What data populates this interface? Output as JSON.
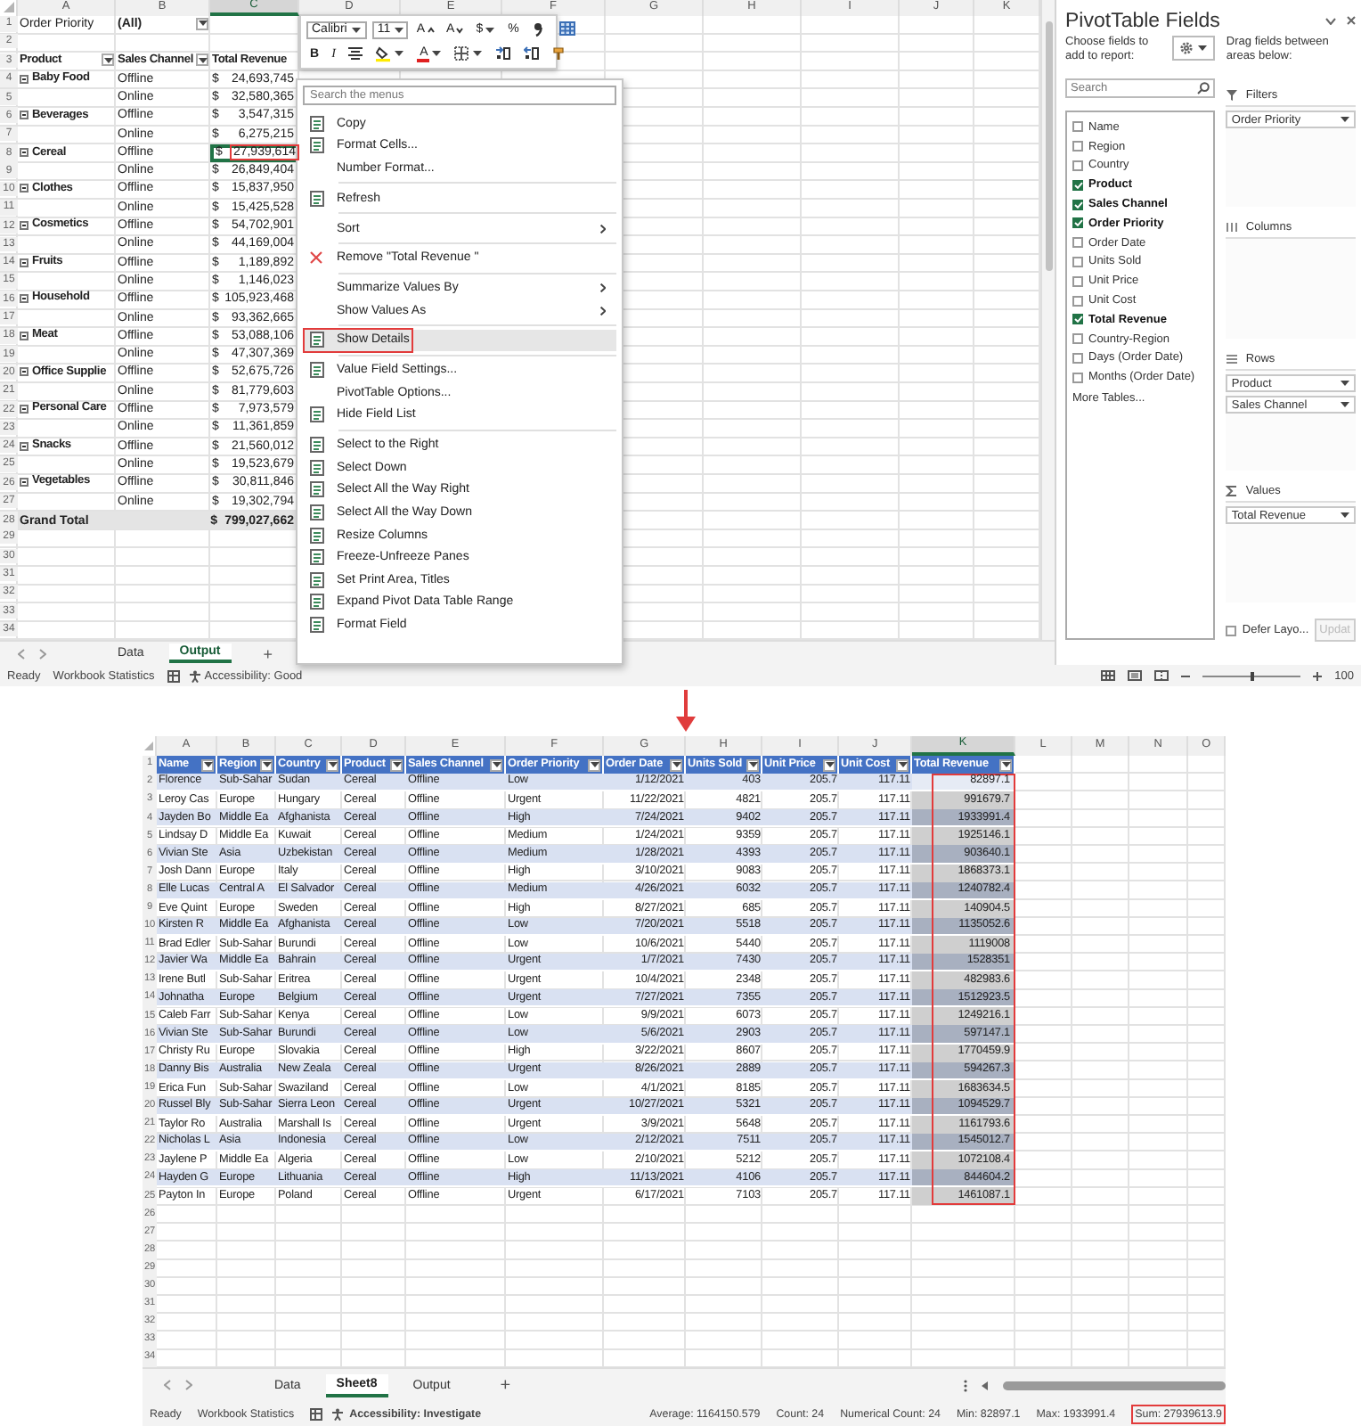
{
  "pivot_sheet": {
    "column_headers": [
      {
        "label": "A",
        "selected": false
      },
      {
        "label": "B",
        "selected": false
      },
      {
        "label": "C",
        "selected": true
      },
      {
        "label": "D",
        "selected": false
      },
      {
        "label": "E",
        "selected": false
      },
      {
        "label": "F",
        "selected": false
      },
      {
        "label": "G",
        "selected": false
      },
      {
        "label": "H",
        "selected": false
      },
      {
        "label": "I",
        "selected": false
      },
      {
        "label": "J",
        "selected": false
      },
      {
        "label": "K",
        "selected": false
      }
    ],
    "row_numbers": [
      "1",
      "2",
      "3",
      "4",
      "5",
      "6",
      "7",
      "8",
      "9",
      "10",
      "11",
      "12",
      "13",
      "14",
      "15",
      "16",
      "17",
      "18",
      "19",
      "20",
      "21",
      "22",
      "23",
      "24",
      "25",
      "26",
      "27",
      "28",
      "29",
      "30",
      "31",
      "32",
      "33",
      "34"
    ],
    "filter": {
      "label": "Order Priority",
      "value": "(All)"
    },
    "headers": [
      "Product",
      "Sales Channel",
      "Total Revenue"
    ],
    "groups": [
      {
        "product": "Baby Food",
        "rows": [
          {
            "channel": "Offline",
            "currency": "$",
            "revenue": "24,693,745",
            "selected": false
          },
          {
            "channel": "Online",
            "currency": "$",
            "revenue": "32,580,365",
            "selected": false
          }
        ]
      },
      {
        "product": "Beverages",
        "rows": [
          {
            "channel": "Offline",
            "currency": "$",
            "revenue": "3,547,315",
            "selected": false
          },
          {
            "channel": "Online",
            "currency": "$",
            "revenue": "6,275,215",
            "selected": false
          }
        ]
      },
      {
        "product": "Cereal",
        "rows": [
          {
            "channel": "Offline",
            "currency": "$",
            "revenue": "27,939,614",
            "selected": true
          },
          {
            "channel": "Online",
            "currency": "$",
            "revenue": "26,849,404",
            "selected": false
          }
        ]
      },
      {
        "product": "Clothes",
        "rows": [
          {
            "channel": "Offline",
            "currency": "$",
            "revenue": "15,837,950",
            "selected": false
          },
          {
            "channel": "Online",
            "currency": "$",
            "revenue": "15,425,528",
            "selected": false
          }
        ]
      },
      {
        "product": "Cosmetics",
        "rows": [
          {
            "channel": "Offline",
            "currency": "$",
            "revenue": "54,702,901",
            "selected": false
          },
          {
            "channel": "Online",
            "currency": "$",
            "revenue": "44,169,004",
            "selected": false
          }
        ]
      },
      {
        "product": "Fruits",
        "rows": [
          {
            "channel": "Offline",
            "currency": "$",
            "revenue": "1,189,892",
            "selected": false
          },
          {
            "channel": "Online",
            "currency": "$",
            "revenue": "1,146,023",
            "selected": false
          }
        ]
      },
      {
        "product": "Household",
        "rows": [
          {
            "channel": "Offline",
            "currency": "$",
            "revenue": "105,923,468",
            "selected": false
          },
          {
            "channel": "Online",
            "currency": "$",
            "revenue": "93,362,665",
            "selected": false
          }
        ]
      },
      {
        "product": "Meat",
        "rows": [
          {
            "channel": "Offline",
            "currency": "$",
            "revenue": "53,088,106",
            "selected": false
          },
          {
            "channel": "Online",
            "currency": "$",
            "revenue": "47,307,369",
            "selected": false
          }
        ]
      },
      {
        "product": "Office Supplie",
        "rows": [
          {
            "channel": "Offline",
            "currency": "$",
            "revenue": "52,675,726",
            "selected": false
          },
          {
            "channel": "Online",
            "currency": "$",
            "revenue": "81,779,603",
            "selected": false
          }
        ]
      },
      {
        "product": "Personal Care",
        "rows": [
          {
            "channel": "Offline",
            "currency": "$",
            "revenue": "7,973,579",
            "selected": false
          },
          {
            "channel": "Online",
            "currency": "$",
            "revenue": "11,361,859",
            "selected": false
          }
        ]
      },
      {
        "product": "Snacks",
        "rows": [
          {
            "channel": "Offline",
            "currency": "$",
            "revenue": "21,560,012",
            "selected": false
          },
          {
            "channel": "Online",
            "currency": "$",
            "revenue": "19,523,679",
            "selected": false
          }
        ]
      },
      {
        "product": "Vegetables",
        "rows": [
          {
            "channel": "Offline",
            "currency": "$",
            "revenue": "30,811,846",
            "selected": false
          },
          {
            "channel": "Online",
            "currency": "$",
            "revenue": "19,302,794",
            "selected": false
          }
        ]
      }
    ],
    "grand_total": {
      "label": "Grand Total",
      "currency": "$",
      "value": "799,027,662"
    },
    "sheet_tabs": [
      {
        "label": "Data",
        "selected": false
      },
      {
        "label": "Output",
        "selected": true
      }
    ],
    "add_sheet": "+"
  },
  "status_bar": {
    "items": [
      "Ready",
      "Workbook Statistics"
    ],
    "accessibility": "Accessibility: Good",
    "zoom_slider": {
      "level": 0.5
    },
    "zoom": "100"
  },
  "mini_toolbar": {
    "font": "Calibri",
    "size": "11",
    "top_row": [
      {
        "kind": "grow",
        "label": "A"
      },
      {
        "kind": "shrink",
        "label": "A"
      },
      {
        "kind": "currency",
        "label": "$"
      },
      {
        "kind": "percent",
        "label": "%"
      },
      {
        "kind": "comma"
      },
      {
        "kind": "table"
      }
    ],
    "bottom_row": [
      {
        "kind": "bold",
        "label": "B"
      },
      {
        "kind": "italic",
        "label": "I"
      },
      {
        "kind": "align"
      },
      {
        "kind": "fill"
      },
      {
        "kind": "fontcolor",
        "label": "A"
      },
      {
        "kind": "border"
      },
      {
        "kind": "increase"
      },
      {
        "kind": "decrease"
      },
      {
        "kind": "brush"
      }
    ]
  },
  "context_menu": {
    "search_placeholder": "Search the menus",
    "groups": [
      [
        {
          "label": "Copy",
          "kind": "icon",
          "highlighted": false
        },
        {
          "label": "Format Cells...",
          "kind": "icon",
          "highlighted": false
        },
        {
          "label": "Number Format...",
          "kind": "plain",
          "highlighted": false
        }
      ],
      [
        {
          "label": "Refresh",
          "kind": "icon",
          "highlighted": false
        }
      ],
      [
        {
          "label": "Sort",
          "kind": "submenu",
          "highlighted": false
        }
      ],
      [
        {
          "label": "Remove \"Total Revenue \"",
          "kind": "remove",
          "highlighted": false
        }
      ],
      [
        {
          "label": "Summarize Values By",
          "kind": "submenu",
          "highlighted": false
        },
        {
          "label": "Show Values As",
          "kind": "submenu",
          "highlighted": false
        }
      ],
      [
        {
          "label": "Show Details",
          "kind": "icon",
          "highlighted": true
        }
      ],
      [
        {
          "label": "Value Field Settings...",
          "kind": "icon",
          "highlighted": false
        },
        {
          "label": "PivotTable Options...",
          "kind": "plain",
          "highlighted": false
        },
        {
          "label": "Hide Field List",
          "kind": "icon",
          "highlighted": false
        }
      ],
      [
        {
          "label": "Select to the Right",
          "kind": "icon",
          "highlighted": false
        },
        {
          "label": "Select Down",
          "kind": "icon",
          "highlighted": false
        },
        {
          "label": "Select All the Way Right",
          "kind": "icon",
          "highlighted": false
        },
        {
          "label": "Select All the Way Down",
          "kind": "icon",
          "highlighted": false
        },
        {
          "label": "Resize Columns",
          "kind": "icon",
          "highlighted": false
        },
        {
          "label": "Freeze-Unfreeze Panes",
          "kind": "icon",
          "highlighted": false
        },
        {
          "label": "Set Print Area, Titles",
          "kind": "icon",
          "highlighted": false
        },
        {
          "label": "Expand Pivot Data Table Range",
          "kind": "icon",
          "highlighted": false
        },
        {
          "label": "Format Field",
          "kind": "icon",
          "highlighted": false
        }
      ]
    ]
  },
  "pivot_fields": {
    "title": "PivotTable Fields",
    "choose_label": "Choose fields to add to report:",
    "search_placeholder": "Search",
    "fields": [
      {
        "label": "Name",
        "checked": false
      },
      {
        "label": "Region",
        "checked": false
      },
      {
        "label": "Country",
        "checked": false
      },
      {
        "label": "Product",
        "checked": true
      },
      {
        "label": "Sales Channel",
        "checked": true
      },
      {
        "label": "Order Priority",
        "checked": true
      },
      {
        "label": "Order Date",
        "checked": false
      },
      {
        "label": "Units Sold",
        "checked": false
      },
      {
        "label": "Unit Price",
        "checked": false
      },
      {
        "label": "Unit Cost",
        "checked": false
      },
      {
        "label": "Total Revenue",
        "checked": true
      },
      {
        "label": "Country-Region",
        "checked": false
      },
      {
        "label": "Days (Order Date)",
        "checked": false
      },
      {
        "label": "Months (Order Date)",
        "checked": false
      }
    ],
    "more_tables": "More Tables...",
    "drag_label": "Drag fields between areas below:",
    "areas": [
      {
        "kind": "filters",
        "label": "Filters",
        "fields": [
          "Order Priority"
        ]
      },
      {
        "kind": "columns",
        "label": "Columns"
      },
      {
        "kind": "rows",
        "label": "Rows",
        "fields": [
          "Product",
          "Sales Channel"
        ]
      },
      {
        "kind": "values",
        "label": "Values",
        "fields": [
          "Total Revenue"
        ]
      }
    ],
    "defer": {
      "label": "Defer Layo...",
      "checked": false
    },
    "update": {
      "label": "Updat",
      "disabled": true
    }
  },
  "detail_sheet": {
    "column_headers": [
      {
        "label": "A",
        "selected": false
      },
      {
        "label": "B",
        "selected": false
      },
      {
        "label": "C",
        "selected": false
      },
      {
        "label": "D",
        "selected": false
      },
      {
        "label": "E",
        "selected": false
      },
      {
        "label": "F",
        "selected": false
      },
      {
        "label": "G",
        "selected": false
      },
      {
        "label": "H",
        "selected": false
      },
      {
        "label": "I",
        "selected": false
      },
      {
        "label": "J",
        "selected": false
      },
      {
        "label": "K",
        "selected": true
      },
      {
        "label": "L",
        "selected": false
      },
      {
        "label": "M",
        "selected": false
      },
      {
        "label": "N",
        "selected": false
      },
      {
        "label": "O",
        "selected": false
      }
    ],
    "row_numbers": [
      "1",
      "2",
      "3",
      "4",
      "5",
      "6",
      "7",
      "8",
      "9",
      "10",
      "11",
      "12",
      "13",
      "14",
      "15",
      "16",
      "17",
      "18",
      "19",
      "20",
      "21",
      "22",
      "23",
      "24",
      "25",
      "26",
      "27",
      "28",
      "29",
      "30",
      "31",
      "32",
      "33",
      "34"
    ],
    "columns": [
      "Name",
      "Region",
      "Country",
      "Product",
      "Sales Channel",
      "Order Priority",
      "Order Date",
      "Units Sold",
      "Unit Price",
      "Unit Cost",
      "Total Revenue"
    ],
    "rows": [
      [
        "Florence",
        "Sub-Sahar",
        "Sudan",
        "Cereal",
        "Offline",
        "Low",
        "1/12/2021",
        "403",
        "205.7",
        "117.11",
        "82897.1"
      ],
      [
        "Leroy Cas",
        "Europe",
        "Hungary",
        "Cereal",
        "Offline",
        "Urgent",
        "11/22/2021",
        "4821",
        "205.7",
        "117.11",
        "991679.7"
      ],
      [
        "Jayden Bo",
        "Middle Ea",
        "Afghanista",
        "Cereal",
        "Offline",
        "High",
        "7/24/2021",
        "9402",
        "205.7",
        "117.11",
        "1933991.4"
      ],
      [
        "Lindsay D",
        "Middle Ea",
        "Kuwait",
        "Cereal",
        "Offline",
        "Medium",
        "1/24/2021",
        "9359",
        "205.7",
        "117.11",
        "1925146.1"
      ],
      [
        "Vivian Ste",
        "Asia",
        "Uzbekistan",
        "Cereal",
        "Offline",
        "Medium",
        "1/28/2021",
        "4393",
        "205.7",
        "117.11",
        "903640.1"
      ],
      [
        "Josh Dann",
        "Europe",
        "Italy",
        "Cereal",
        "Offline",
        "High",
        "3/10/2021",
        "9083",
        "205.7",
        "117.11",
        "1868373.1"
      ],
      [
        "Elle Lucas",
        "Central A",
        "El Salvador",
        "Cereal",
        "Offline",
        "Medium",
        "4/26/2021",
        "6032",
        "205.7",
        "117.11",
        "1240782.4"
      ],
      [
        "Eve Quint",
        "Europe",
        "Sweden",
        "Cereal",
        "Offline",
        "High",
        "8/27/2021",
        "685",
        "205.7",
        "117.11",
        "140904.5"
      ],
      [
        "Kirsten R",
        "Middle Ea",
        "Afghanista",
        "Cereal",
        "Offline",
        "Low",
        "7/20/2021",
        "5518",
        "205.7",
        "117.11",
        "1135052.6"
      ],
      [
        "Brad Edler",
        "Sub-Sahar",
        "Burundi",
        "Cereal",
        "Offline",
        "Low",
        "10/6/2021",
        "5440",
        "205.7",
        "117.11",
        "1119008"
      ],
      [
        "Javier Wa",
        "Middle Ea",
        "Bahrain",
        "Cereal",
        "Offline",
        "Urgent",
        "1/7/2021",
        "7430",
        "205.7",
        "117.11",
        "1528351"
      ],
      [
        "Irene Butl",
        "Sub-Sahar",
        "Eritrea",
        "Cereal",
        "Offline",
        "Urgent",
        "10/4/2021",
        "2348",
        "205.7",
        "117.11",
        "482983.6"
      ],
      [
        "Johnatha",
        "Europe",
        "Belgium",
        "Cereal",
        "Offline",
        "Urgent",
        "7/27/2021",
        "7355",
        "205.7",
        "117.11",
        "1512923.5"
      ],
      [
        "Caleb Farr",
        "Sub-Sahar",
        "Kenya",
        "Cereal",
        "Offline",
        "Low",
        "9/9/2021",
        "6073",
        "205.7",
        "117.11",
        "1249216.1"
      ],
      [
        "Vivian Ste",
        "Sub-Sahar",
        "Burundi",
        "Cereal",
        "Offline",
        "Low",
        "5/6/2021",
        "2903",
        "205.7",
        "117.11",
        "597147.1"
      ],
      [
        "Christy Ru",
        "Europe",
        "Slovakia",
        "Cereal",
        "Offline",
        "High",
        "3/22/2021",
        "8607",
        "205.7",
        "117.11",
        "1770459.9"
      ],
      [
        "Danny Bis",
        "Australia",
        "New Zeala",
        "Cereal",
        "Offline",
        "Urgent",
        "8/26/2021",
        "2889",
        "205.7",
        "117.11",
        "594267.3"
      ],
      [
        "Erica Fun",
        "Sub-Sahar",
        "Swaziland",
        "Cereal",
        "Offline",
        "Low",
        "4/1/2021",
        "8185",
        "205.7",
        "117.11",
        "1683634.5"
      ],
      [
        "Russel Bly",
        "Sub-Sahar",
        "Sierra Leon",
        "Cereal",
        "Offline",
        "Urgent",
        "10/27/2021",
        "5321",
        "205.7",
        "117.11",
        "1094529.7"
      ],
      [
        "Taylor Ro",
        "Australia",
        "Marshall Is",
        "Cereal",
        "Offline",
        "Urgent",
        "3/9/2021",
        "5648",
        "205.7",
        "117.11",
        "1161793.6"
      ],
      [
        "Nicholas L",
        "Asia",
        "Indonesia",
        "Cereal",
        "Offline",
        "Low",
        "2/12/2021",
        "7511",
        "205.7",
        "117.11",
        "1545012.7"
      ],
      [
        "Jaylene P",
        "Middle Ea",
        "Algeria",
        "Cereal",
        "Offline",
        "Low",
        "2/10/2021",
        "5212",
        "205.7",
        "117.11",
        "1072108.4"
      ],
      [
        "Hayden G",
        "Europe",
        "Lithuania",
        "Cereal",
        "Offline",
        "High",
        "11/13/2021",
        "4106",
        "205.7",
        "117.11",
        "844604.2"
      ],
      [
        "Payton In",
        "Europe",
        "Poland",
        "Cereal",
        "Offline",
        "Urgent",
        "6/17/2021",
        "7103",
        "205.7",
        "117.11",
        "1461087.1"
      ]
    ],
    "sheet_tabs": [
      {
        "label": "Data",
        "selected": false
      },
      {
        "label": "Sheet8",
        "selected": true
      },
      {
        "label": "Output",
        "selected": false
      }
    ],
    "add_sheet": "+",
    "status_bar": {
      "items": [
        "Ready",
        "Workbook Statistics"
      ],
      "accessibility": "Accessibility: Investigate",
      "stats": [
        {
          "label": "Average: 1164150.579",
          "highlighted": false
        },
        {
          "label": "Count: 24",
          "highlighted": false
        },
        {
          "label": "Numerical Count: 24",
          "highlighted": false
        },
        {
          "label": "Min: 82897.1",
          "highlighted": false
        },
        {
          "label": "Max: 1933991.4",
          "highlighted": false
        },
        {
          "label": "Sum: 27939613.9",
          "highlighted": true
        }
      ]
    }
  }
}
